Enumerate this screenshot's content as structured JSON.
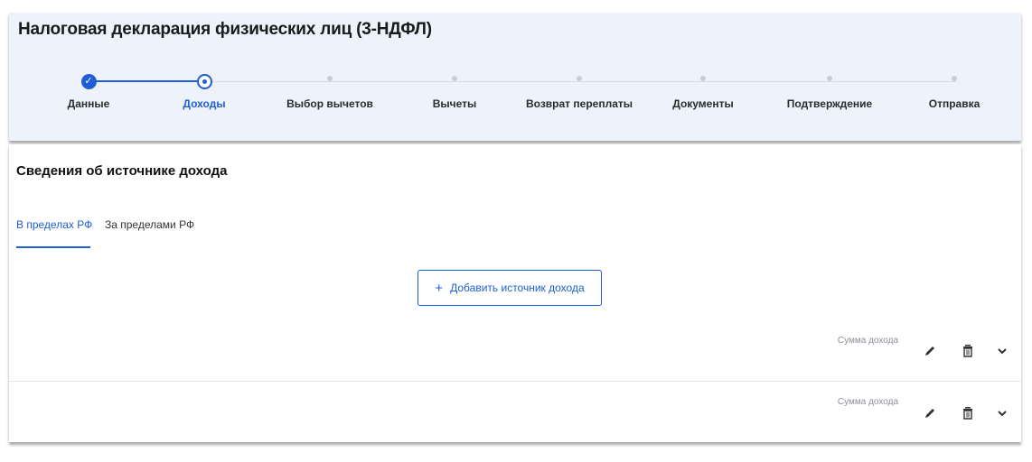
{
  "header": {
    "title": "Налоговая декларация физических лиц (3-НДФЛ)"
  },
  "stepper": {
    "steps": [
      {
        "label": "Данные",
        "state": "done"
      },
      {
        "label": "Доходы",
        "state": "current"
      },
      {
        "label": "Выбор вычетов",
        "state": "pending"
      },
      {
        "label": "Вычеты",
        "state": "pending"
      },
      {
        "label": "Возврат переплаты",
        "state": "pending"
      },
      {
        "label": "Документы",
        "state": "pending"
      },
      {
        "label": "Подтверждение",
        "state": "pending"
      },
      {
        "label": "Отправка",
        "state": "pending"
      }
    ]
  },
  "section": {
    "title": "Сведения об источнике дохода"
  },
  "tabs": [
    {
      "label": "В пределах РФ",
      "active": true
    },
    {
      "label": "За пределами РФ",
      "active": false
    }
  ],
  "add_button": {
    "icon": "+",
    "label": "Добавить источник дохода"
  },
  "rows": [
    {
      "sum_label": "Сумма дохода"
    },
    {
      "sum_label": "Сумма дохода"
    }
  ],
  "colors": {
    "accent": "#1e5ed6",
    "header_bg": "#eef2fb",
    "muted_text": "#8b8f97"
  },
  "icons": {
    "done_step": "check-icon",
    "current_step": "radio-dot-icon",
    "edit": "pencil-icon",
    "delete": "trash-icon",
    "expand": "chevron-down-icon"
  }
}
